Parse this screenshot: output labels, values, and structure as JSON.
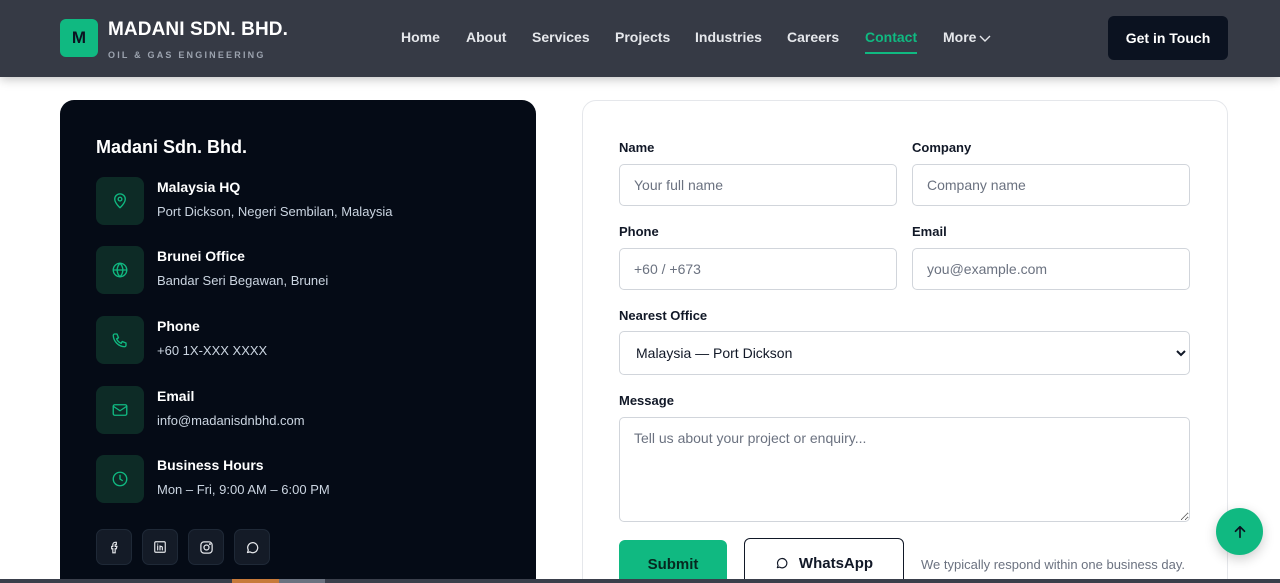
{
  "header": {
    "logo_letter": "M",
    "brand_name": "MADANI SDN. BHD.",
    "brand_tagline": "OIL & GAS ENGINEERING",
    "nav": [
      {
        "label": "Home"
      },
      {
        "label": "About"
      },
      {
        "label": "Services"
      },
      {
        "label": "Projects"
      },
      {
        "label": "Industries"
      },
      {
        "label": "Careers"
      },
      {
        "label": "Contact",
        "active": true
      },
      {
        "label": "More"
      }
    ],
    "cta_label": "Get in Touch"
  },
  "info": {
    "title": "Madani Sdn. Bhd.",
    "items": [
      {
        "icon": "map-pin-icon",
        "label": "Malaysia HQ",
        "value": "Port Dickson, Negeri Sembilan, Malaysia"
      },
      {
        "icon": "globe-icon",
        "label": "Brunei Office",
        "value": "Bandar Seri Begawan, Brunei"
      },
      {
        "icon": "phone-icon",
        "label": "Phone",
        "value": "+60 1X-XXX XXXX"
      },
      {
        "icon": "mail-icon",
        "label": "Email",
        "value": "info@madanisdnbhd.com"
      },
      {
        "icon": "clock-icon",
        "label": "Business Hours",
        "value": "Mon – Fri, 9:00 AM – 6:00 PM"
      }
    ],
    "social": [
      "facebook-icon",
      "linkedin-icon",
      "instagram-icon",
      "whatsapp-icon"
    ]
  },
  "form": {
    "name_label": "Name",
    "name_placeholder": "Your full name",
    "company_label": "Company",
    "company_placeholder": "Company name",
    "phone_label": "Phone",
    "phone_placeholder": "+60 / +673",
    "email_label": "Email",
    "email_placeholder": "you@example.com",
    "office_label": "Nearest Office",
    "office_value": "Malaysia — Port Dickson",
    "message_label": "Message",
    "message_placeholder": "Tell us about your project or enquiry...",
    "submit_label": "Submit",
    "whatsapp_label": "WhatsApp",
    "respond_note": "We typically respond within one business day."
  },
  "colors": {
    "accent": "#10b981",
    "header_bg": "#363a45",
    "card_dark": "#050b16",
    "icon_tile": "#0d2b26"
  }
}
